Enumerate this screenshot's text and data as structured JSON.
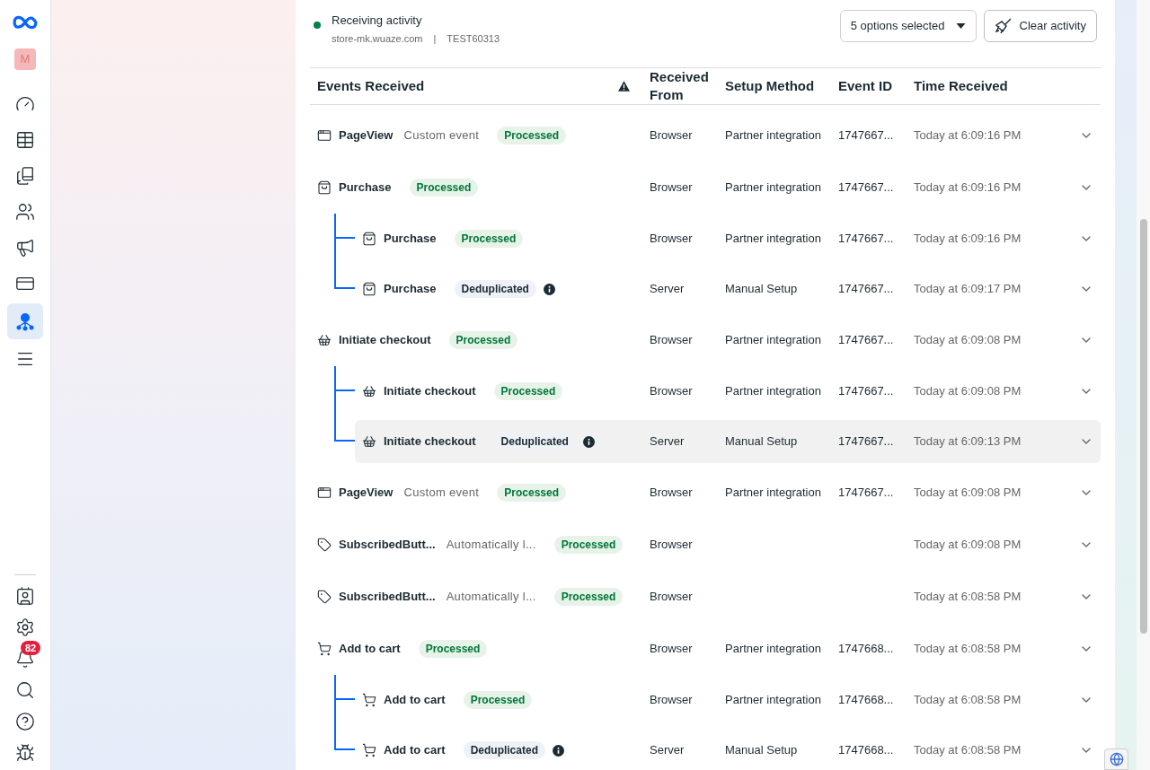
{
  "sidebar": {
    "avatar": "M",
    "items": [
      {
        "selected": false
      },
      {
        "selected": false
      },
      {
        "selected": false
      },
      {
        "selected": false
      },
      {
        "selected": false
      },
      {
        "selected": false
      },
      {
        "selected": true
      },
      {
        "selected": false
      }
    ],
    "notifications": "82"
  },
  "activity": {
    "label": "Receiving activity",
    "active": true,
    "domain": "store-mk.wuaze.com",
    "separator": "|",
    "pixel_id": "TEST60313"
  },
  "filter": {
    "label": "5 options selected"
  },
  "clear_button": {
    "label": "Clear activity"
  },
  "columns": [
    "Events Received",
    "Received From",
    "Setup Method",
    "Event ID",
    "Time Received"
  ],
  "events": [
    {
      "kind": "page",
      "name": "PageView",
      "subtitle": "Custom event",
      "status": {
        "label": "Processed",
        "kind": "processed"
      },
      "from": "Browser",
      "method": "Partner integration",
      "id": "1747667...",
      "time": "Today at 6:09:16 PM",
      "selected": false
    },
    {
      "kind": "bag",
      "name": "Purchase",
      "status": {
        "label": "Processed",
        "kind": "processed"
      },
      "from": "Browser",
      "method": "Partner integration",
      "id": "1747667...",
      "time": "Today at 6:09:16 PM",
      "selected": false,
      "children": [
        {
          "kind": "bag",
          "name": "Purchase",
          "status": {
            "label": "Processed",
            "kind": "processed"
          },
          "from": "Browser",
          "method": "Partner integration",
          "id": "1747667...",
          "time": "Today at 6:09:16 PM",
          "selected": false
        },
        {
          "kind": "bag",
          "name": "Purchase",
          "status": {
            "label": "Deduplicated",
            "kind": "deduplicated"
          },
          "from": "Server",
          "method": "Manual Setup",
          "id": "1747667...",
          "time": "Today at 6:09:17 PM",
          "selected": false
        }
      ]
    },
    {
      "kind": "basket",
      "name": "Initiate checkout",
      "status": {
        "label": "Processed",
        "kind": "processed"
      },
      "from": "Browser",
      "method": "Partner integration",
      "id": "1747667...",
      "time": "Today at 6:09:08 PM",
      "selected": false,
      "children": [
        {
          "kind": "basket",
          "name": "Initiate checkout",
          "status": {
            "label": "Processed",
            "kind": "processed"
          },
          "from": "Browser",
          "method": "Partner integration",
          "id": "1747667...",
          "time": "Today at 6:09:08 PM",
          "selected": false
        },
        {
          "kind": "basket",
          "name": "Initiate checkout",
          "status": {
            "label": "Deduplicated",
            "kind": "deduplicated"
          },
          "from": "Server",
          "method": "Manual Setup",
          "id": "1747667...",
          "time": "Today at 6:09:13 PM",
          "selected": true
        }
      ]
    },
    {
      "kind": "page",
      "name": "PageView",
      "subtitle": "Custom event",
      "status": {
        "label": "Processed",
        "kind": "processed"
      },
      "from": "Browser",
      "method": "Partner integration",
      "id": "1747667...",
      "time": "Today at 6:09:08 PM",
      "selected": false
    },
    {
      "kind": "tag",
      "name": "SubscribedButt...",
      "subtitle": "Automatically l...",
      "status": {
        "label": "Processed",
        "kind": "processed"
      },
      "from": "Browser",
      "time": "Today at 6:09:08 PM",
      "selected": false
    },
    {
      "kind": "tag",
      "name": "SubscribedButt...",
      "subtitle": "Automatically l...",
      "status": {
        "label": "Processed",
        "kind": "processed"
      },
      "from": "Browser",
      "time": "Today at 6:08:58 PM",
      "selected": false
    },
    {
      "kind": "cart",
      "name": "Add to cart",
      "status": {
        "label": "Processed",
        "kind": "processed"
      },
      "from": "Browser",
      "method": "Partner integration",
      "id": "1747668...",
      "time": "Today at 6:08:58 PM",
      "selected": false,
      "children": [
        {
          "kind": "cart",
          "name": "Add to cart",
          "status": {
            "label": "Processed",
            "kind": "processed"
          },
          "from": "Browser",
          "method": "Partner integration",
          "id": "1747668...",
          "time": "Today at 6:08:58 PM",
          "selected": false
        },
        {
          "kind": "cart",
          "name": "Add to cart",
          "status": {
            "label": "Deduplicated",
            "kind": "deduplicated"
          },
          "from": "Server",
          "method": "Manual Setup",
          "id": "1747668...",
          "time": "Today at 6:08:58 PM",
          "selected": false
        }
      ]
    }
  ]
}
